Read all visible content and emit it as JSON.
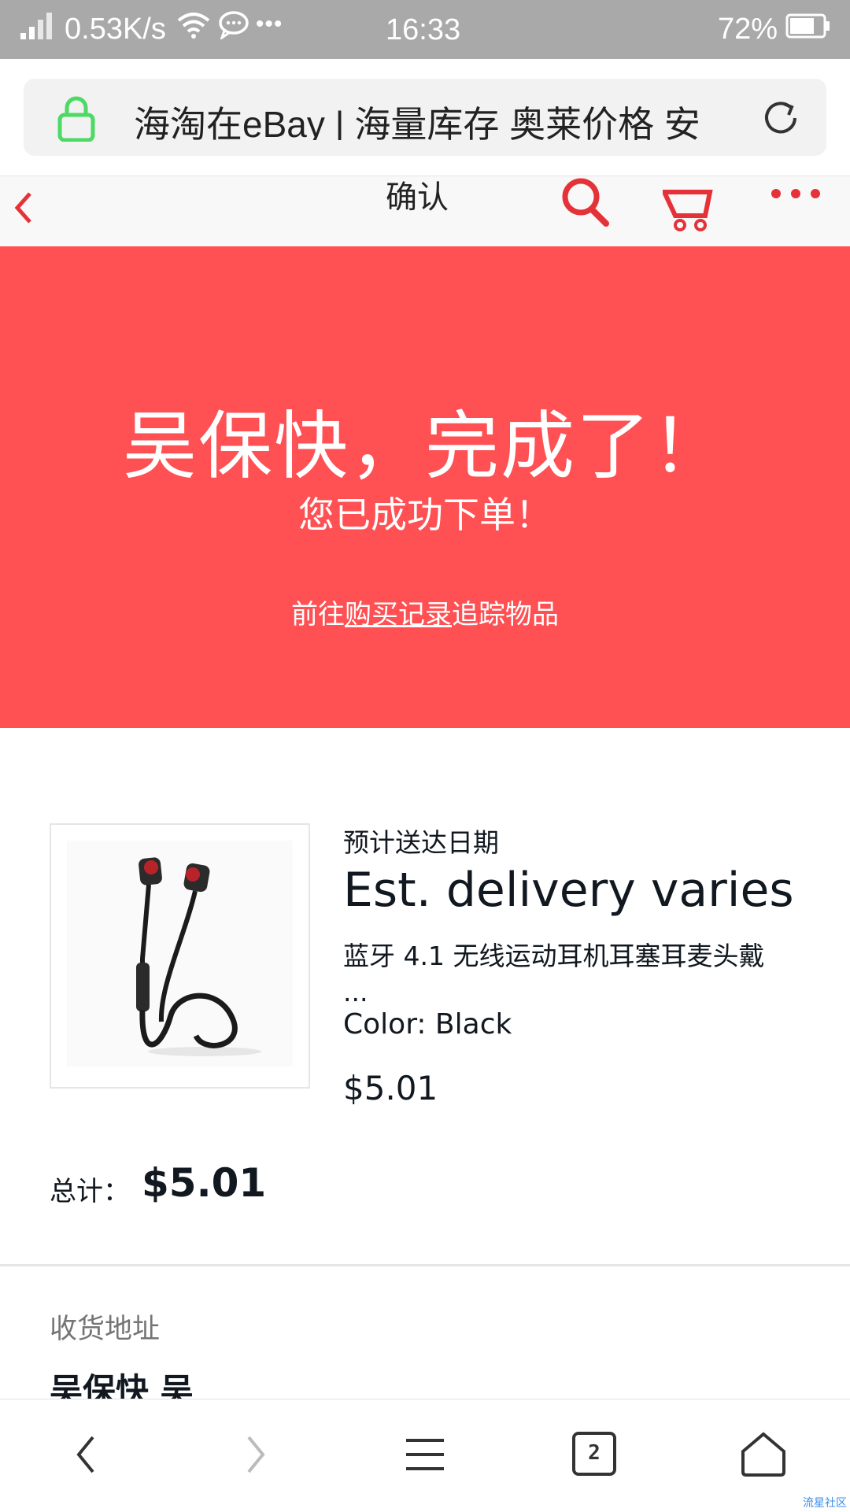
{
  "status_bar": {
    "net_speed": "0.53K/s",
    "time": "16:33",
    "battery_percent": "72%",
    "icons": [
      "signal-icon",
      "wifi-icon",
      "chat-icon",
      "more-dots-icon",
      "battery-icon"
    ]
  },
  "browser": {
    "address_title": "海淘在eBay | 海量库存 奥莱价格 安",
    "tab_count": "2"
  },
  "header": {
    "title": "确认"
  },
  "banner": {
    "headline": "吴保快，完成了！",
    "subline": "您已成功下单！",
    "track_prefix": "前往",
    "track_link": "购买记录",
    "track_suffix": "追踪物品",
    "color": "#ff5053"
  },
  "item": {
    "delivery_label": "预计送达日期",
    "delivery_value": "Est. delivery varies",
    "title": "蓝牙 4.1 无线运动耳机耳塞耳麦头戴",
    "title_ellipsis": "...",
    "color": "Color: Black",
    "price": "$5.01"
  },
  "total": {
    "label": "总计：",
    "value": "$5.01"
  },
  "shipping": {
    "label": "收货地址",
    "name": "吴保快 吴"
  },
  "footer": {
    "watermark": "流星社区"
  },
  "colors": {
    "accent": "#e53238",
    "banner": "#ff5053",
    "lock": "#4cd964"
  }
}
